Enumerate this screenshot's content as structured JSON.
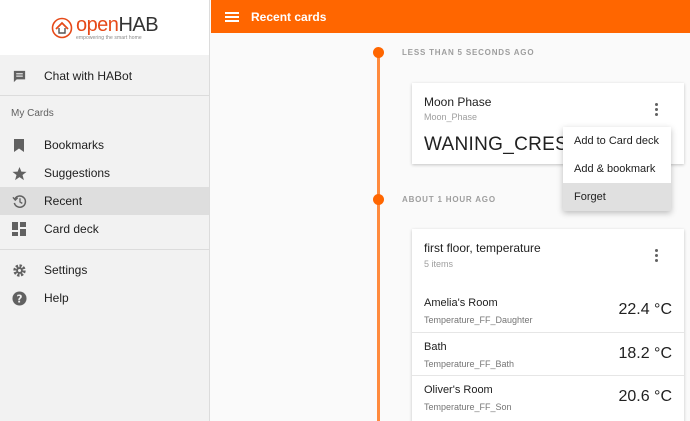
{
  "brand": {
    "name_o": "o",
    "name_pen": "pen",
    "name_hab": "HAB",
    "tagline": "empowering the smart home"
  },
  "sidebar": {
    "habot_label": "Chat with HABot",
    "section_label": "My Cards",
    "items": [
      {
        "label": "Bookmarks",
        "icon": "bookmark-icon"
      },
      {
        "label": "Suggestions",
        "icon": "star-icon"
      },
      {
        "label": "Recent",
        "icon": "history-icon",
        "active": true
      },
      {
        "label": "Card deck",
        "icon": "dashboard-icon"
      }
    ],
    "footer_items": [
      {
        "label": "Settings",
        "icon": "gear-icon"
      },
      {
        "label": "Help",
        "icon": "help-icon"
      }
    ]
  },
  "header": {
    "title": "Recent cards"
  },
  "timeline": {
    "groups": [
      {
        "label": "LESS THAN 5 SECONDS AGO"
      },
      {
        "label": "ABOUT 1 HOUR AGO"
      }
    ]
  },
  "cards": {
    "moon": {
      "title": "Moon Phase",
      "item": "Moon_Phase",
      "value": "WANING_CRESCENT"
    },
    "temp": {
      "title": "first floor, temperature",
      "subtitle": "5 items",
      "rows": [
        {
          "name": "Amelia's Room",
          "item": "Temperature_FF_Daughter",
          "value": "22.4 °C"
        },
        {
          "name": "Bath",
          "item": "Temperature_FF_Bath",
          "value": "18.2 °C"
        },
        {
          "name": "Oliver's Room",
          "item": "Temperature_FF_Son",
          "value": "20.6 °C"
        }
      ]
    }
  },
  "context_menu": {
    "items": [
      {
        "label": "Add to Card deck"
      },
      {
        "label": "Add & bookmark"
      },
      {
        "label": "Forget",
        "hovered": true
      }
    ]
  },
  "colors": {
    "accent": "#ff6600",
    "timeline": "#ff8a3d"
  }
}
